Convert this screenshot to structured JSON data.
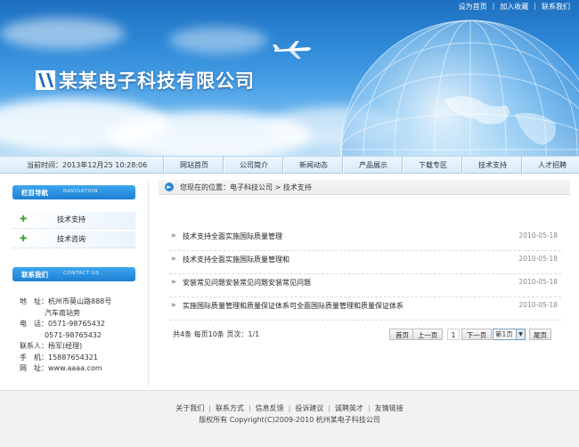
{
  "top_links": [
    "设为首页",
    "加入收藏",
    "联系我们"
  ],
  "brand": {
    "name": "某某电子科技有限公司"
  },
  "date_line": "当前时间：2013年12月25 10:28:06",
  "nav": [
    "网站首页",
    "公司简介",
    "新闻动态",
    "产品展示",
    "下载专区",
    "技术支持",
    "人才招聘"
  ],
  "sidebar": {
    "nav_title": "栏目导航",
    "nav_title_en": "NAVIGATION",
    "items": [
      "技术支持",
      "技术咨询"
    ],
    "contact_title": "联系我们",
    "contact_title_en": "CONTACT US",
    "contact": {
      "address_label": "地　址：",
      "address_1": "杭州市莫山路888号",
      "address_2": "汽车南站旁",
      "phone_label": "电　话：",
      "phone_1": "0571-98765432",
      "phone_2": "0571-98765432",
      "person_label": "联系人：",
      "person": "杨军(经理)",
      "mobile_label": "手　机：",
      "mobile": "15887654321",
      "web_label": "网　址：",
      "web": "www.aaaa.com"
    }
  },
  "breadcrumb": "您现在的位置：电子科技公司 > 技术支持",
  "articles": [
    {
      "title": "技术支持全面实施国际质量管理",
      "date": "2010-05-18"
    },
    {
      "title": "技术支持全面实施国际质量管理和",
      "date": "2010-05-18"
    },
    {
      "title": "安装常见问题安装常见问题安装常见问题",
      "date": "2010-05-18"
    },
    {
      "title": "实施国际质量管理和质量保证体系可全面国际质量管理和质量保证体系",
      "date": "2010-05-18"
    }
  ],
  "pagination": {
    "info": "共4条  每页10条  页次：1/1",
    "first": "首页",
    "prev": "上一页",
    "current": "1",
    "next": "下一页",
    "select_value": "第1页",
    "last": "尾页"
  },
  "footer": {
    "links": [
      "关于我们",
      "联系方式",
      "信息反馈",
      "投诉建议",
      "诚聘英才",
      "友情链接"
    ],
    "copyright": "版权所有  Copyright(C)2009-2010 杭州某电子科技公司"
  }
}
